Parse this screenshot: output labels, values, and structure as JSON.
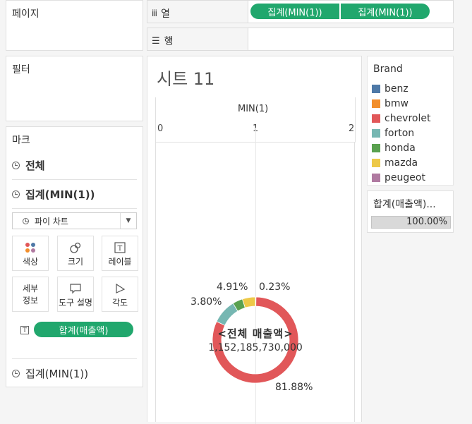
{
  "pages_shelf": {
    "title": "페이지"
  },
  "filters_shelf": {
    "title": "필터"
  },
  "columns_shelf": {
    "label": "열",
    "pills": [
      "집계(MIN(1))",
      "집계(MIN(1))"
    ]
  },
  "rows_shelf": {
    "label": "행"
  },
  "marks_card": {
    "title": "마크",
    "all_label": "전체",
    "layer1_label": "집계(MIN(1))",
    "mark_type": "파이 차트",
    "buttons": {
      "color": "색상",
      "size": "크기",
      "label": "레이블",
      "detail": "세부\n정보",
      "tooltip": "도구 설명",
      "angle": "각도"
    },
    "angle_pill": "합계(매출액)",
    "layer2_label": "집계(MIN(1))"
  },
  "sheet": {
    "title": "시트 11"
  },
  "axis": {
    "title": "MIN(1)",
    "ticks": [
      "0",
      "1",
      "2"
    ]
  },
  "center_label": {
    "title": "<전체 매출액>",
    "value": "1,152,185,730,000"
  },
  "pie_labels": {
    "honda": "3.80%",
    "mazda": "4.91%",
    "peugeot": "0.23%",
    "chevrolet": "81.88%"
  },
  "legend": {
    "title": "Brand",
    "items": [
      {
        "name": "benz",
        "color": "#4e79a7"
      },
      {
        "name": "bmw",
        "color": "#f28e2b"
      },
      {
        "name": "chevrolet",
        "color": "#e15759"
      },
      {
        "name": "forton",
        "color": "#76b7b2"
      },
      {
        "name": "honda",
        "color": "#59a14f"
      },
      {
        "name": "mazda",
        "color": "#edc948"
      },
      {
        "name": "peugeot",
        "color": "#b07aa1"
      }
    ]
  },
  "size_legend": {
    "title": "합계(매출액)...",
    "value": "100.00%"
  },
  "chart_data": {
    "type": "pie",
    "series": [
      {
        "name": "benz",
        "value": 0.23
      },
      {
        "name": "bmw",
        "value": 0.0
      },
      {
        "name": "chevrolet",
        "value": 81.88
      },
      {
        "name": "forton",
        "value": 9.18
      },
      {
        "name": "honda",
        "value": 3.8
      },
      {
        "name": "mazda",
        "value": 4.91
      },
      {
        "name": "peugeot",
        "value": 0.0
      }
    ]
  }
}
